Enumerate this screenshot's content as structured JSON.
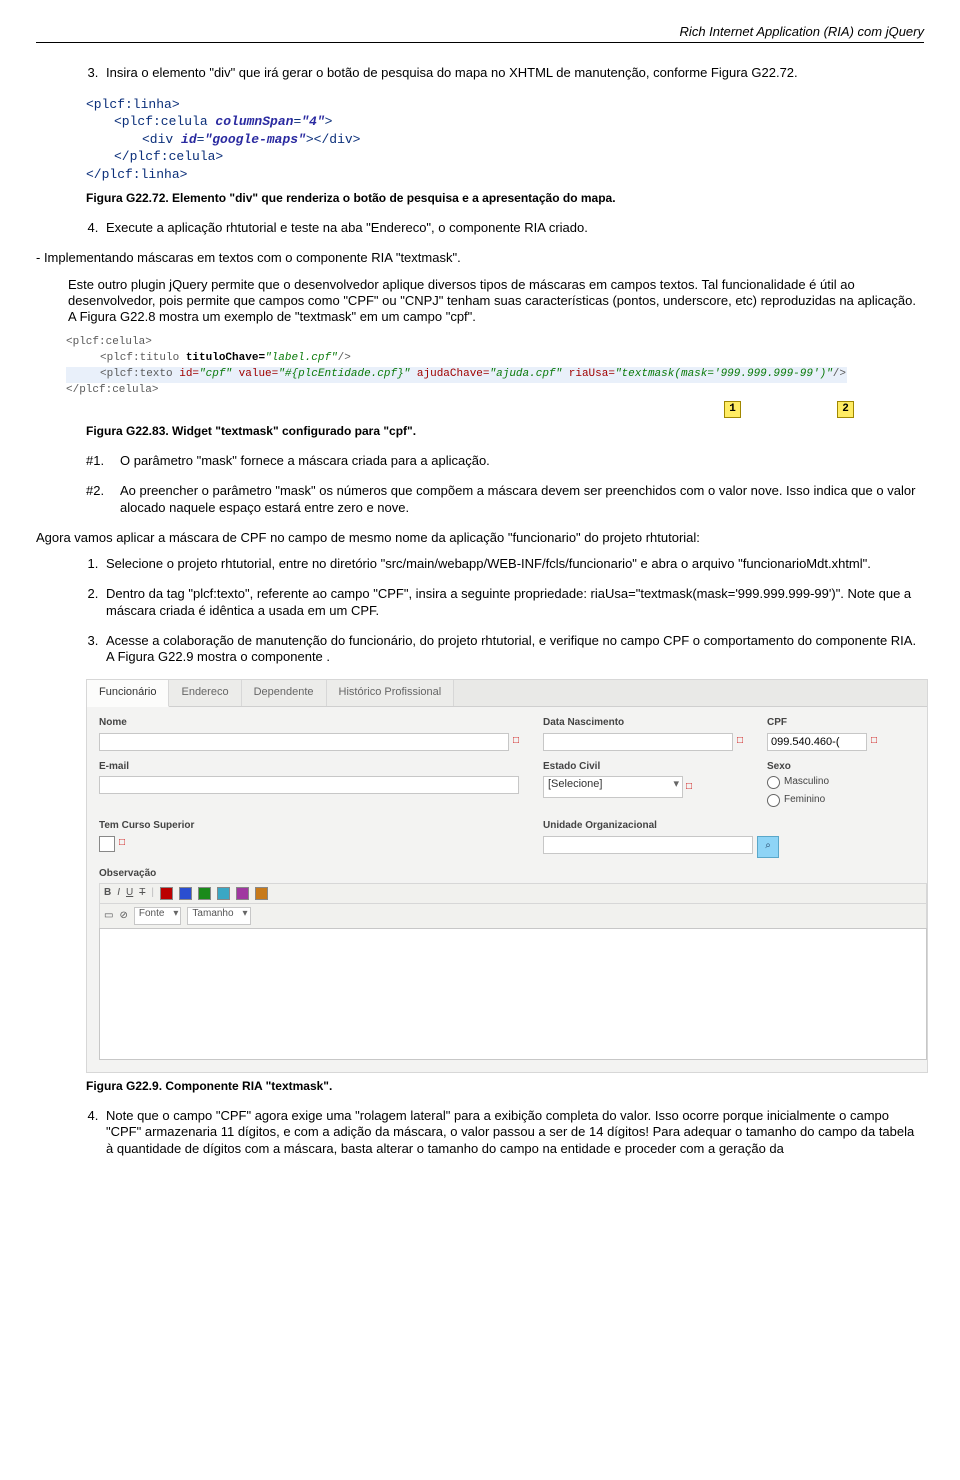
{
  "header": "Rich Internet Application (RIA) com jQuery",
  "list1": {
    "item3": "Insira o elemento \"div\" que irá gerar o botão de pesquisa do mapa no XHTML de manutenção, conforme Figura G22.72.",
    "item4": "Execute a aplicação rhtutorial e teste na aba \"Endereco\", o componente RIA criado."
  },
  "code1": {
    "l1": "<plcf:linha>",
    "l2": "<plcf:celula ",
    "l2a": "columnSpan",
    "l2v": "\"4\"",
    "l2e": ">",
    "l3": "<div ",
    "l3a": "id",
    "l3v": "\"google-maps\"",
    "l3e": "></div>",
    "l4": "</plcf:celula>",
    "l5": "</plcf:linha>"
  },
  "fig72": "Figura G22.72. Elemento \"div\" que renderiza o botão de pesquisa e a apresentação do mapa.",
  "sect_dash": "- Implementando máscaras em textos com o componente RIA \"textmask\".",
  "para_textmask": "Este outro plugin jQuery permite que o desenvolvedor aplique diversos tipos de máscaras em campos textos. Tal funcionalidade é útil ao desenvolvedor, pois permite que campos como \"CPF\" ou \"CNPJ\" tenham suas características (pontos, underscore, etc) reproduzidas na aplicação. A Figura G22.8 mostra um exemplo de \"textmask\" em um campo \"cpf\".",
  "code2": {
    "l1": "<plcf:celula>",
    "l2a": "<plcf:titulo ",
    "l2b": "tituloChave=",
    "l2c": "\"label.cpf\"",
    "l2d": "/>",
    "l3a": "<plcf:texto ",
    "l3b": "id=",
    "l3c": "\"cpf\"",
    "l3d": " value=",
    "l3e": "\"#{plcEntidade.cpf}\"",
    "l3f": " ajudaChave=",
    "l3g": "\"ajuda.cpf\"",
    "l3h": " riaUsa=",
    "l3i": "\"textmask(mask='999.999.999-99')\"",
    "l3j": "/>",
    "l4": "</plcf:celula>"
  },
  "callouts": {
    "c1": "1",
    "c2": "2"
  },
  "fig83": "Figura G22.83. Widget \"textmask\" configurado para \"cpf\".",
  "hash1_n": "#1.",
  "hash1_t": "O parâmetro \"mask\" fornece a máscara criada para a aplicação.",
  "hash2_n": "#2.",
  "hash2_t": "Ao preencher o parâmetro \"mask\" os números que compõem a máscara devem ser preenchidos com o valor nove. Isso indica que o valor alocado naquele espaço estará entre zero e nove.",
  "para_agora": "Agora vamos aplicar a máscara de CPF no campo de mesmo nome da aplicação \"funcionario\" do projeto rhtutorial:",
  "list2": {
    "i1": "Selecione o projeto rhtutorial, entre no diretório \"src/main/webapp/WEB-INF/fcls/funcionario\" e abra o arquivo \"funcionarioMdt.xhtml\".",
    "i2": "Dentro da tag \"plcf:texto\", referente ao campo \"CPF\", insira a seguinte propriedade: riaUsa=\"textmask(mask='999.999.999-99')\". Note que a máscara criada é idêntica a usada em um CPF.",
    "i3": "Acesse a colaboração de manutenção do funcionário, do projeto rhtutorial, e verifique no campo CPF o comportamento do componente RIA. A Figura G22.9 mostra o componente .",
    "i4": "Note que o campo \"CPF\" agora exige uma \"rolagem lateral\" para a exibição completa do valor. Isso ocorre porque inicialmente o campo \"CPF\" armazenaria 11 dígitos, e com a adição da máscara, o valor passou a ser de 14 dígitos! Para adequar o tamanho do campo da tabela à quantidade de dígitos com a máscara, basta alterar o tamanho do campo na entidade e proceder com a geração da"
  },
  "form": {
    "tabs": [
      "Funcionário",
      "Endereco",
      "Dependente",
      "Histórico Profissional"
    ],
    "labels": {
      "nome": "Nome",
      "data": "Data Nascimento",
      "cpf": "CPF",
      "email": "E-mail",
      "estado": "Estado Civil",
      "sexo": "Sexo",
      "curso": "Tem Curso Superior",
      "org": "Unidade Organizacional",
      "obs": "Observação"
    },
    "cpf_value": "099.540.460-(",
    "estado_value": "[Selecione]",
    "sexo_m": "Masculino",
    "sexo_f": "Feminino",
    "toolbar": {
      "fonte": "Fonte",
      "tamanho": "Tamanho"
    }
  },
  "fig9": "Figura G22.9. Componente RIA \"textmask\"."
}
